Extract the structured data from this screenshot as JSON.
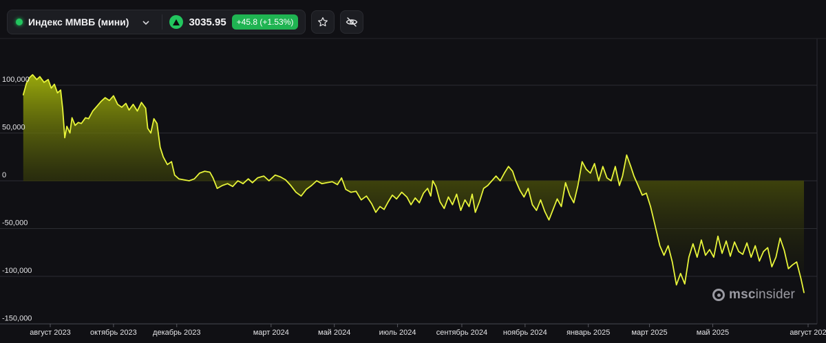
{
  "header": {
    "instrument_name": "Индекс ММВБ (мини)",
    "price": "3035.95",
    "change": "+45.8 (+1.53%)",
    "status_color": "#22c55e",
    "change_color": "#1fb452"
  },
  "watermark": {
    "bold": "msc",
    "rest": "insider"
  },
  "chart_data": {
    "type": "area",
    "title": "",
    "xlabel": "",
    "ylabel": "",
    "line_color": "#e8f53a",
    "ylim": [
      -150000,
      150000
    ],
    "y_ticks": [
      {
        "value": 100000,
        "label": "100,000"
      },
      {
        "value": 50000,
        "label": "50,000"
      },
      {
        "value": 0,
        "label": "0"
      },
      {
        "value": -50000,
        "label": "-50,000"
      },
      {
        "value": -100000,
        "label": "-100,000"
      },
      {
        "value": -150000,
        "label": "-150,000"
      }
    ],
    "x_ticks": [
      {
        "date": "2023-08-01",
        "label": "август 2023"
      },
      {
        "date": "2023-10-01",
        "label": "октябрь 2023"
      },
      {
        "date": "2023-12-01",
        "label": "декабрь 2023"
      },
      {
        "date": "2024-03-01",
        "label": "март 2024"
      },
      {
        "date": "2024-05-01",
        "label": "май 2024"
      },
      {
        "date": "2024-07-01",
        "label": "июль 2024"
      },
      {
        "date": "2024-09-01",
        "label": "сентябрь 2024"
      },
      {
        "date": "2024-11-01",
        "label": "ноябрь 2024"
      },
      {
        "date": "2025-01-01",
        "label": "январь 2025"
      },
      {
        "date": "2025-03-01",
        "label": "март 2025"
      },
      {
        "date": "2025-05-01",
        "label": "май 2025"
      },
      {
        "date": "2025-08-01",
        "label": "август 202"
      }
    ],
    "series": [
      {
        "points": [
          [
            "2023-07-06",
            90000
          ],
          [
            "2023-07-09",
            102000
          ],
          [
            "2023-07-12",
            108000
          ],
          [
            "2023-07-15",
            111000
          ],
          [
            "2023-07-19",
            106000
          ],
          [
            "2023-07-22",
            109000
          ],
          [
            "2023-07-26",
            103000
          ],
          [
            "2023-07-30",
            106000
          ],
          [
            "2023-08-02",
            97000
          ],
          [
            "2023-08-05",
            101000
          ],
          [
            "2023-08-08",
            92000
          ],
          [
            "2023-08-11",
            95000
          ],
          [
            "2023-08-13",
            75000
          ],
          [
            "2023-08-15",
            45000
          ],
          [
            "2023-08-17",
            57000
          ],
          [
            "2023-08-20",
            50000
          ],
          [
            "2023-08-22",
            66000
          ],
          [
            "2023-08-25",
            58000
          ],
          [
            "2023-08-28",
            61000
          ],
          [
            "2023-08-31",
            60000
          ],
          [
            "2023-09-04",
            66000
          ],
          [
            "2023-09-07",
            65000
          ],
          [
            "2023-09-11",
            73000
          ],
          [
            "2023-09-15",
            78000
          ],
          [
            "2023-09-19",
            83000
          ],
          [
            "2023-09-23",
            87000
          ],
          [
            "2023-09-27",
            84000
          ],
          [
            "2023-10-01",
            89000
          ],
          [
            "2023-10-05",
            80000
          ],
          [
            "2023-10-09",
            77000
          ],
          [
            "2023-10-13",
            81000
          ],
          [
            "2023-10-16",
            74000
          ],
          [
            "2023-10-20",
            80000
          ],
          [
            "2023-10-24",
            73000
          ],
          [
            "2023-10-28",
            82000
          ],
          [
            "2023-11-01",
            76000
          ],
          [
            "2023-11-03",
            55000
          ],
          [
            "2023-11-06",
            50000
          ],
          [
            "2023-11-09",
            65000
          ],
          [
            "2023-11-12",
            60000
          ],
          [
            "2023-11-15",
            35000
          ],
          [
            "2023-11-18",
            25000
          ],
          [
            "2023-11-22",
            17000
          ],
          [
            "2023-11-26",
            20000
          ],
          [
            "2023-11-29",
            6000
          ],
          [
            "2023-12-03",
            2000
          ],
          [
            "2023-12-08",
            1000
          ],
          [
            "2023-12-13",
            0
          ],
          [
            "2023-12-18",
            2000
          ],
          [
            "2023-12-23",
            8000
          ],
          [
            "2023-12-28",
            10000
          ],
          [
            "2024-01-02",
            9000
          ],
          [
            "2024-01-05",
            3000
          ],
          [
            "2024-01-09",
            -8000
          ],
          [
            "2024-01-14",
            -5000
          ],
          [
            "2024-01-19",
            -3000
          ],
          [
            "2024-01-24",
            -6000
          ],
          [
            "2024-01-29",
            0
          ],
          [
            "2024-02-03",
            -3000
          ],
          [
            "2024-02-08",
            2000
          ],
          [
            "2024-02-12",
            -2000
          ],
          [
            "2024-02-17",
            3000
          ],
          [
            "2024-02-23",
            5000
          ],
          [
            "2024-02-28",
            0
          ],
          [
            "2024-03-05",
            6000
          ],
          [
            "2024-03-10",
            4000
          ],
          [
            "2024-03-15",
            1000
          ],
          [
            "2024-03-20",
            -5000
          ],
          [
            "2024-03-25",
            -12000
          ],
          [
            "2024-03-30",
            -16000
          ],
          [
            "2024-04-04",
            -9000
          ],
          [
            "2024-04-09",
            -5000
          ],
          [
            "2024-04-14",
            0
          ],
          [
            "2024-04-19",
            -3000
          ],
          [
            "2024-04-24",
            -2000
          ],
          [
            "2024-04-29",
            -1000
          ],
          [
            "2024-05-04",
            -4000
          ],
          [
            "2024-05-08",
            3000
          ],
          [
            "2024-05-12",
            -9000
          ],
          [
            "2024-05-17",
            -12000
          ],
          [
            "2024-05-22",
            -11000
          ],
          [
            "2024-05-27",
            -20000
          ],
          [
            "2024-06-01",
            -16000
          ],
          [
            "2024-06-06",
            -24000
          ],
          [
            "2024-06-10",
            -33000
          ],
          [
            "2024-06-14",
            -27000
          ],
          [
            "2024-06-18",
            -30000
          ],
          [
            "2024-06-22",
            -22000
          ],
          [
            "2024-06-26",
            -15000
          ],
          [
            "2024-06-30",
            -19000
          ],
          [
            "2024-07-05",
            -12000
          ],
          [
            "2024-07-10",
            -17000
          ],
          [
            "2024-07-14",
            -25000
          ],
          [
            "2024-07-18",
            -18000
          ],
          [
            "2024-07-22",
            -23000
          ],
          [
            "2024-07-26",
            -13000
          ],
          [
            "2024-07-30",
            -8000
          ],
          [
            "2024-08-02",
            -16000
          ],
          [
            "2024-08-04",
            0
          ],
          [
            "2024-08-07",
            -6000
          ],
          [
            "2024-08-11",
            -22000
          ],
          [
            "2024-08-15",
            -29000
          ],
          [
            "2024-08-19",
            -17000
          ],
          [
            "2024-08-23",
            -25000
          ],
          [
            "2024-08-27",
            -14000
          ],
          [
            "2024-08-31",
            -31000
          ],
          [
            "2024-09-04",
            -20000
          ],
          [
            "2024-09-08",
            -27000
          ],
          [
            "2024-09-11",
            -14000
          ],
          [
            "2024-09-14",
            -33000
          ],
          [
            "2024-09-18",
            -22000
          ],
          [
            "2024-09-22",
            -8000
          ],
          [
            "2024-09-26",
            -5000
          ],
          [
            "2024-09-30",
            0
          ],
          [
            "2024-10-04",
            5000
          ],
          [
            "2024-10-08",
            0
          ],
          [
            "2024-10-12",
            8000
          ],
          [
            "2024-10-16",
            15000
          ],
          [
            "2024-10-20",
            10000
          ],
          [
            "2024-10-23",
            0
          ],
          [
            "2024-10-27",
            -10000
          ],
          [
            "2024-10-31",
            -17000
          ],
          [
            "2024-11-04",
            -8000
          ],
          [
            "2024-11-08",
            -25000
          ],
          [
            "2024-11-12",
            -31000
          ],
          [
            "2024-11-16",
            -20000
          ],
          [
            "2024-11-20",
            -32000
          ],
          [
            "2024-11-24",
            -41000
          ],
          [
            "2024-11-28",
            -30000
          ],
          [
            "2024-12-02",
            -19000
          ],
          [
            "2024-12-06",
            -27000
          ],
          [
            "2024-12-10",
            -2000
          ],
          [
            "2024-12-14",
            -15000
          ],
          [
            "2024-12-18",
            -23000
          ],
          [
            "2024-12-22",
            -5000
          ],
          [
            "2024-12-26",
            20000
          ],
          [
            "2024-12-30",
            12000
          ],
          [
            "2025-01-03",
            8000
          ],
          [
            "2025-01-07",
            18000
          ],
          [
            "2025-01-11",
            0
          ],
          [
            "2025-01-15",
            15000
          ],
          [
            "2025-01-19",
            3000
          ],
          [
            "2025-01-23",
            0
          ],
          [
            "2025-01-27",
            15000
          ],
          [
            "2025-01-31",
            -5000
          ],
          [
            "2025-02-03",
            5000
          ],
          [
            "2025-02-07",
            27000
          ],
          [
            "2025-02-11",
            15000
          ],
          [
            "2025-02-14",
            5000
          ],
          [
            "2025-02-18",
            -5000
          ],
          [
            "2025-02-22",
            -15000
          ],
          [
            "2025-02-26",
            -13000
          ],
          [
            "2025-03-02",
            -27000
          ],
          [
            "2025-03-06",
            -45000
          ],
          [
            "2025-03-11",
            -68000
          ],
          [
            "2025-03-15",
            -78000
          ],
          [
            "2025-03-19",
            -68000
          ],
          [
            "2025-03-23",
            -85000
          ],
          [
            "2025-03-27",
            -109000
          ],
          [
            "2025-03-31",
            -97000
          ],
          [
            "2025-04-04",
            -108000
          ],
          [
            "2025-04-08",
            -80000
          ],
          [
            "2025-04-12",
            -66000
          ],
          [
            "2025-04-16",
            -80000
          ],
          [
            "2025-04-20",
            -62000
          ],
          [
            "2025-04-24",
            -78000
          ],
          [
            "2025-04-28",
            -72000
          ],
          [
            "2025-05-02",
            -80000
          ],
          [
            "2025-05-06",
            -58000
          ],
          [
            "2025-05-10",
            -76000
          ],
          [
            "2025-05-14",
            -63000
          ],
          [
            "2025-05-18",
            -79000
          ],
          [
            "2025-05-22",
            -64000
          ],
          [
            "2025-05-26",
            -74000
          ],
          [
            "2025-05-30",
            -77000
          ],
          [
            "2025-06-03",
            -65000
          ],
          [
            "2025-06-07",
            -80000
          ],
          [
            "2025-06-11",
            -68000
          ],
          [
            "2025-06-15",
            -84000
          ],
          [
            "2025-06-19",
            -74000
          ],
          [
            "2025-06-23",
            -70000
          ],
          [
            "2025-06-27",
            -90000
          ],
          [
            "2025-07-01",
            -80000
          ],
          [
            "2025-07-05",
            -60000
          ],
          [
            "2025-07-09",
            -73000
          ],
          [
            "2025-07-13",
            -92000
          ],
          [
            "2025-07-17",
            -88000
          ],
          [
            "2025-07-21",
            -85000
          ],
          [
            "2025-07-25",
            -102000
          ],
          [
            "2025-07-28",
            -117000
          ]
        ]
      }
    ]
  }
}
